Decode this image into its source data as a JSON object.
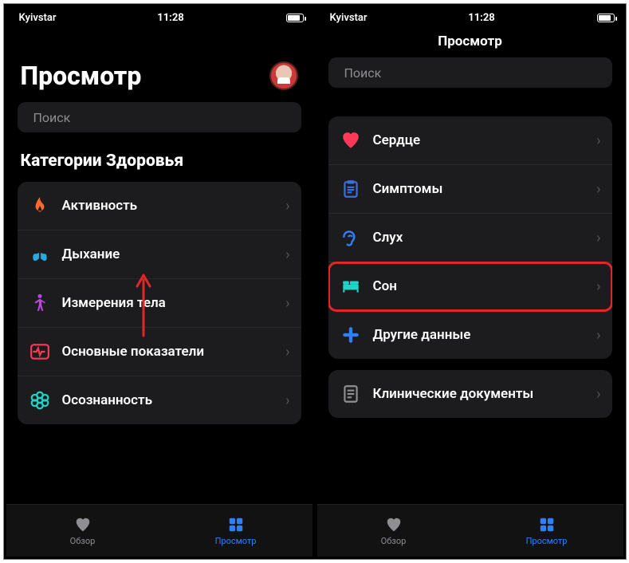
{
  "statusbar": {
    "carrier": "Kyivstar",
    "time": "11:28"
  },
  "left": {
    "title": "Просмотр",
    "search_placeholder": "Поиск",
    "section_title": "Категории Здоровья",
    "categories": [
      {
        "label": "Активность",
        "icon": "flame"
      },
      {
        "label": "Дыхание",
        "icon": "lungs"
      },
      {
        "label": "Измерения тела",
        "icon": "body"
      },
      {
        "label": "Основные показатели",
        "icon": "vitals"
      },
      {
        "label": "Осознанность",
        "icon": "mindfulness"
      }
    ],
    "tabs": {
      "summary": "Обзор",
      "browse": "Просмотр"
    }
  },
  "right": {
    "title": "Просмотр",
    "search_placeholder": "Поиск",
    "categories": [
      {
        "label": "Сердце",
        "icon": "heart"
      },
      {
        "label": "Симптомы",
        "icon": "clipboard"
      },
      {
        "label": "Слух",
        "icon": "ear"
      },
      {
        "label": "Сон",
        "icon": "bed",
        "highlight": true
      },
      {
        "label": "Другие данные",
        "icon": "plus"
      }
    ],
    "clinical_label": "Клинические документы",
    "tabs": {
      "summary": "Обзор",
      "browse": "Просмотр"
    }
  }
}
